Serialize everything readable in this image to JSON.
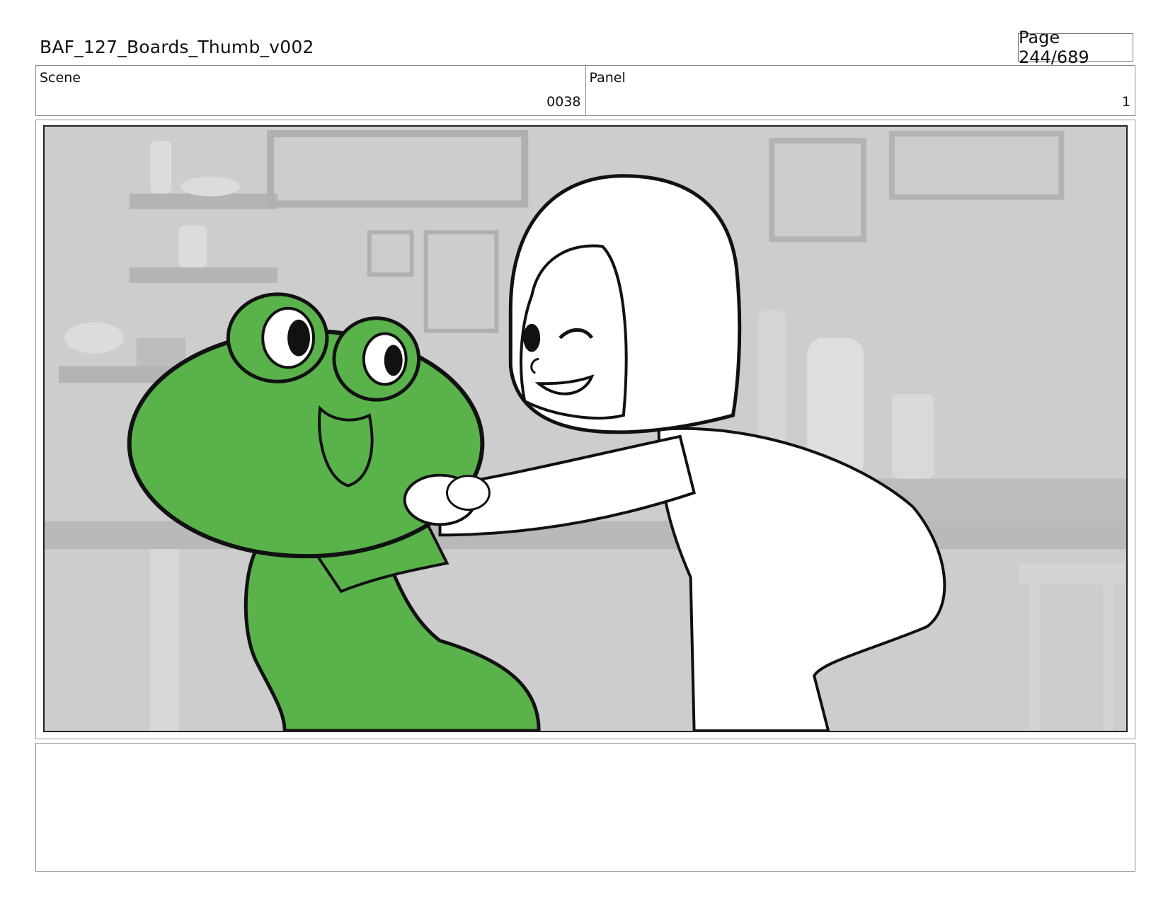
{
  "header": {
    "title": "BAF_127_Boards_Thumb_v002",
    "page": "Page 244/689"
  },
  "info": {
    "scene_label": "Scene",
    "scene_value": "0038",
    "panel_label": "Panel",
    "panel_value": "1"
  },
  "artwork": {
    "description_icon": "storyboard-panel-image",
    "colors": {
      "background": "#c9c9c9",
      "frog_green": "#5ab24b",
      "line": "#111111",
      "girl_fill": "#ffffff"
    }
  },
  "notes": {
    "text": ""
  }
}
